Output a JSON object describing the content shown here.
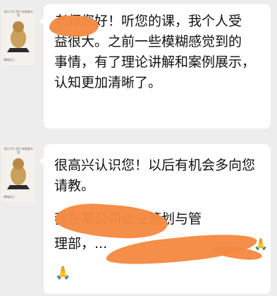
{
  "messages": [
    {
      "avatar": {
        "caption": "现在不同 我只有最美的我",
        "name": "情绪自己"
      },
      "lines": [
        "老师您好！听您的课，我个人受",
        "益很大。之前一些模糊感觉到的",
        "事情，有了理论讲解和案例展示，",
        "认知更加清晰了。"
      ]
    },
    {
      "avatar": {
        "caption": "现在不同 我只有最美的我",
        "name": "情绪自己"
      },
      "lines": [
        "很高兴认识您！以后有机会多向您",
        "请教。",
        "我在某公司企业管划与管",
        "理部，..."
      ],
      "emoji": "🙏🙏"
    }
  ]
}
